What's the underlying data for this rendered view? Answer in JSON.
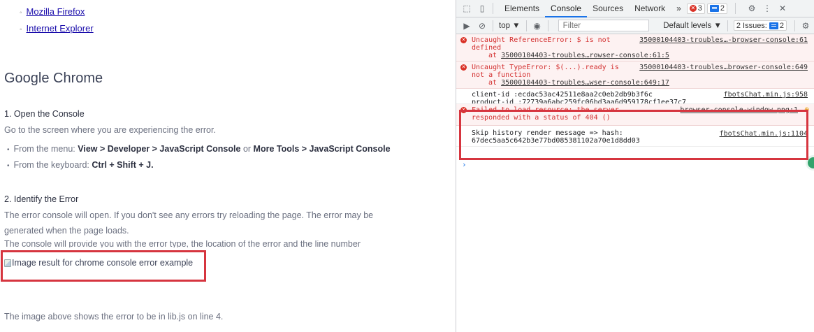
{
  "article": {
    "links": [
      "Mozilla Firefox",
      "Internet Explorer"
    ],
    "heading": "Google Chrome",
    "step1_title": "1. Open the Console",
    "step1_text": "Go to the screen where you are experiencing the error.",
    "menu_prefix": "From the menu:",
    "menu_path1": "View > Developer > JavaScript Console",
    "menu_or": "or",
    "menu_path2": "More Tools > JavaScript Console",
    "keyboard_prefix": "From the keyboard:",
    "keyboard_shortcut": "Ctrl + Shift + J.",
    "step2_title": "2. Identify the Error",
    "step2_text": "The error console will open. If you don't see any errors try reloading the page. The error may be generated when the page loads.",
    "step2_clipped": "The console will provide you with the error type, the location of the error and the line number",
    "broken_image_alt": "Image result for chrome console error example",
    "footer_text": "The image above shows the error to be in lib.js on line 4."
  },
  "devtools": {
    "tabs": [
      "Elements",
      "Console",
      "Sources",
      "Network"
    ],
    "active_tab": "Console",
    "more_tabs": "»",
    "error_count": "3",
    "message_count": "2",
    "context": "top ▼",
    "filter_placeholder": "Filter",
    "levels": "Default levels ▼",
    "issues_label": "2 Issues:",
    "issues_count": "2",
    "messages": [
      {
        "type": "error",
        "text": "Uncaught ReferenceError: $ is not\ndefined",
        "source": "35000104403-troubles…-browser-console:61",
        "trace_prefix": "at",
        "trace_link": "35000104403-troubles…rowser-console:61:5"
      },
      {
        "type": "error",
        "text": "Uncaught TypeError: $(...).ready is\nnot a function",
        "source": "35000104403-troubles…browser-console:649",
        "trace_prefix": "at",
        "trace_link": "35000104403-troubles…wser-console:649:17"
      },
      {
        "type": "log",
        "text": "client-id :ecdac53ac42511e8aa2c0eb2db9b3f6c\nproduct-id :72739a6abc259fc06bd3aa6d959178cf1ee37c7",
        "source": "fbotsChat.min.js:958"
      },
      {
        "type": "error",
        "text": "Failed to load resource: the server\nresponded with a status of 404 ()",
        "source": "browser-console-window.png:1"
      },
      {
        "type": "log",
        "text": "Skip history render message => hash:\n67dec5aa5c642b3e77bd085381102a70e1d8dd03",
        "source": "fbotsChat.min.js:1104"
      }
    ],
    "prompt": "›"
  },
  "colors": {
    "highlight": "#d6353f",
    "error_text": "#d32f2f",
    "link": "#1a0dab",
    "accent": "#1a73e8"
  }
}
